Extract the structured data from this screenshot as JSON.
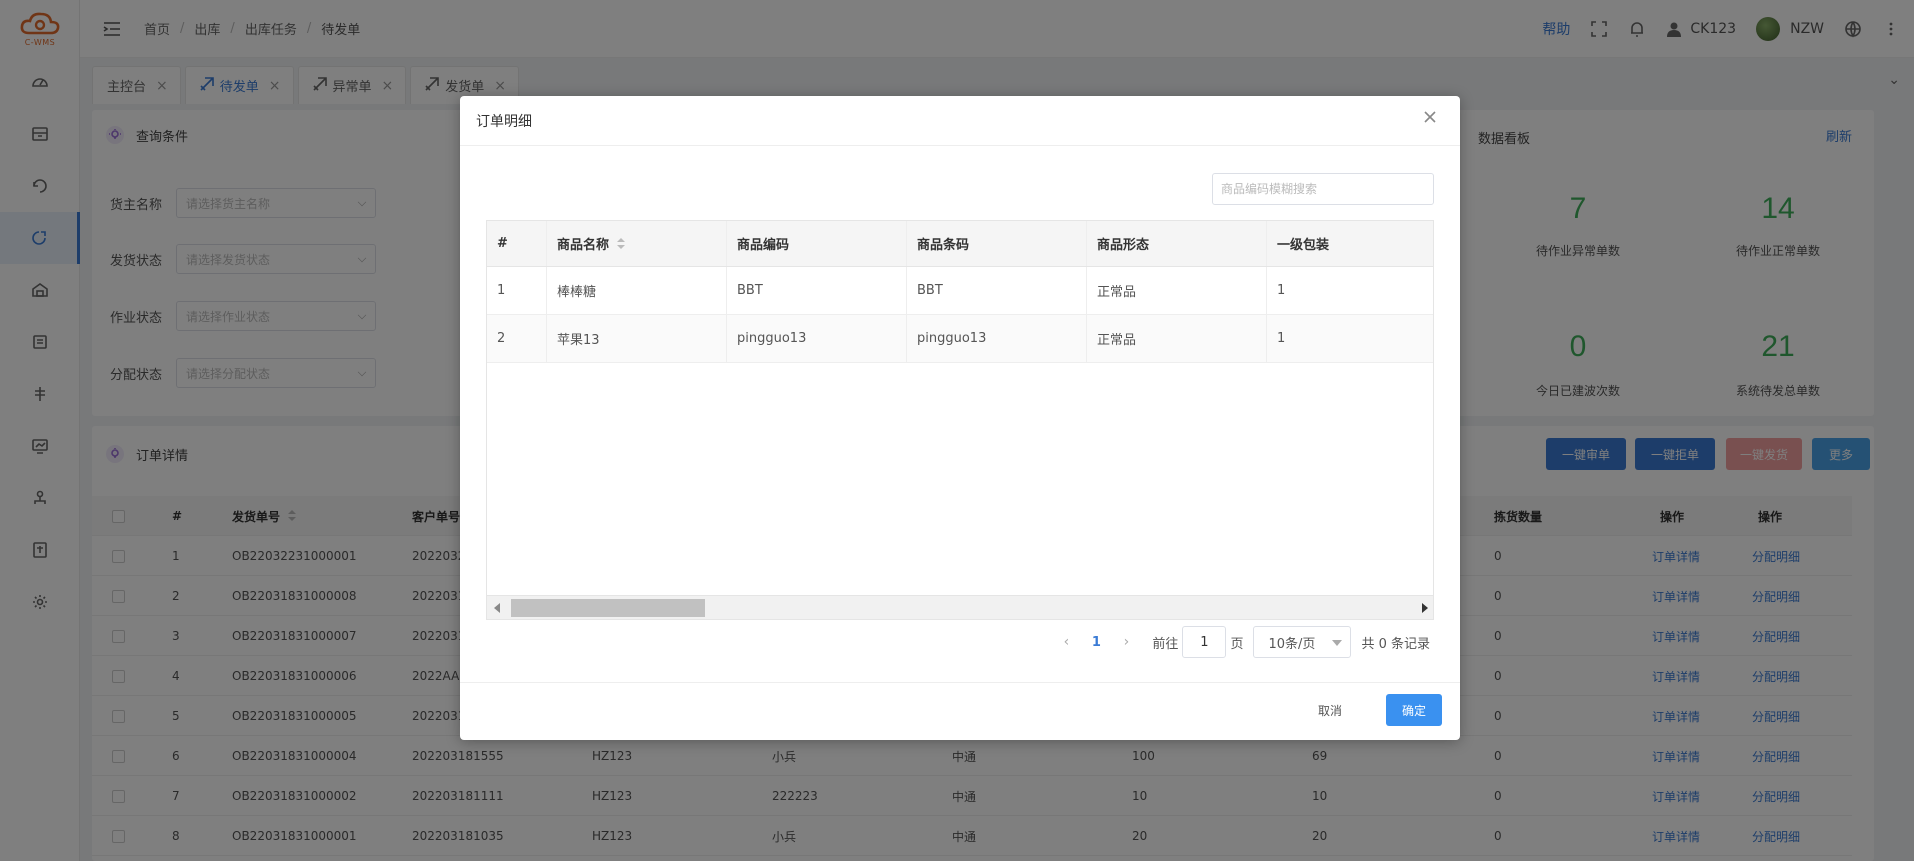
{
  "header": {
    "breadcrumb": [
      "首页",
      "出库",
      "出库任务",
      "待发单"
    ],
    "help": "帮助",
    "warehouse": "CK123",
    "username": "NZW"
  },
  "logo_text": "C-WMS",
  "tabs": [
    {
      "label": "主控台"
    },
    {
      "label": "待发单"
    },
    {
      "label": "异常单"
    },
    {
      "label": "发货单"
    }
  ],
  "query_panel": {
    "title": "查询条件",
    "fields": [
      {
        "label": "货主名称",
        "placeholder": "请选择货主名称"
      },
      {
        "label": "发货状态",
        "placeholder": "请选择发货状态"
      },
      {
        "label": "作业状态",
        "placeholder": "请选择作业状态"
      },
      {
        "label": "分配状态",
        "placeholder": "请选择分配状态"
      }
    ]
  },
  "dashboard": {
    "title": "数据看板",
    "refresh": "刷新",
    "stats": [
      {
        "value": "7",
        "label": "待作业异常单数"
      },
      {
        "value": "14",
        "label": "待作业正常单数"
      },
      {
        "value": "0",
        "label": "今日已建波次数"
      },
      {
        "value": "21",
        "label": "系统待发总单数"
      }
    ]
  },
  "orders_panel": {
    "title": "订单详情",
    "buttons": {
      "audit": "一键审单",
      "reject": "一键拒单",
      "ship": "一键发货",
      "more": "更多"
    },
    "columns": [
      "#",
      "发货单号",
      "客户单号",
      "拣货数量",
      "操作",
      "操作"
    ],
    "op_labels": {
      "detail": "订单详情",
      "alloc": "分配明细"
    },
    "rows": [
      {
        "idx": "1",
        "no": "OB22032231000001",
        "cust": "2022032",
        "c3": "",
        "c4": "",
        "c5": "",
        "c6": "",
        "c7": "",
        "pick": "0"
      },
      {
        "idx": "2",
        "no": "OB22031831000008",
        "cust": "2022031",
        "c3": "",
        "c4": "",
        "c5": "",
        "c6": "",
        "c7": "",
        "pick": "0"
      },
      {
        "idx": "3",
        "no": "OB22031831000007",
        "cust": "2022031",
        "c3": "",
        "c4": "",
        "c5": "",
        "c6": "",
        "c7": "",
        "pick": "0"
      },
      {
        "idx": "4",
        "no": "OB22031831000006",
        "cust": "2022AA",
        "c3": "",
        "c4": "",
        "c5": "",
        "c6": "",
        "c7": "",
        "pick": "0"
      },
      {
        "idx": "5",
        "no": "OB22031831000005",
        "cust": "2022031",
        "c3": "",
        "c4": "",
        "c5": "",
        "c6": "",
        "c7": "",
        "pick": "0"
      },
      {
        "idx": "6",
        "no": "OB22031831000004",
        "cust": "202203181555",
        "c3": "HZ123",
        "c4": "小兵",
        "c5": "中通",
        "c6": "100",
        "c7": "69",
        "pick": "0"
      },
      {
        "idx": "7",
        "no": "OB22031831000002",
        "cust": "202203181111",
        "c3": "HZ123",
        "c4": "222223",
        "c5": "中通",
        "c6": "10",
        "c7": "10",
        "pick": "0"
      },
      {
        "idx": "8",
        "no": "OB22031831000001",
        "cust": "202203181035",
        "c3": "HZ123",
        "c4": "小兵",
        "c5": "中通",
        "c6": "20",
        "c7": "20",
        "pick": "0"
      }
    ]
  },
  "modal": {
    "title": "订单明细",
    "search_placeholder": "商品编码模糊搜索",
    "columns": [
      "#",
      "商品名称",
      "商品编码",
      "商品条码",
      "商品形态",
      "一级包装"
    ],
    "rows": [
      {
        "idx": "1",
        "name": "棒棒糖",
        "code": "BBT",
        "barcode": "BBT",
        "form": "正常品",
        "pack": "1"
      },
      {
        "idx": "2",
        "name": "苹果13",
        "code": "pingguo13",
        "barcode": "pingguo13",
        "form": "正常品",
        "pack": "1"
      }
    ],
    "pager": {
      "prev": "‹",
      "current": "1",
      "next": "›",
      "goto_label": "前往",
      "goto_value": "1",
      "page_unit": "页",
      "page_size": "10条/页",
      "total": "共 0 条记录"
    },
    "cancel": "取消",
    "confirm": "确定"
  }
}
